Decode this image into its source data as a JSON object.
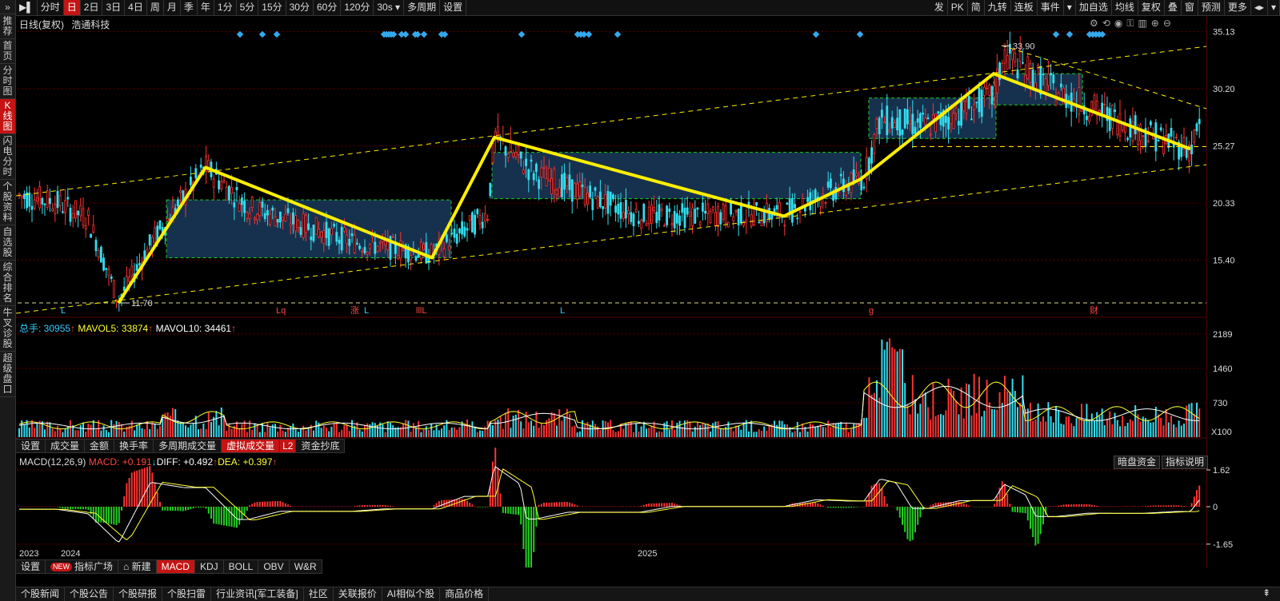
{
  "left_nav": [
    "推荐",
    "首页",
    "分时图",
    "K线图",
    "闪电分时",
    "个股资料",
    "自选股",
    "综合排名",
    "牛叉诊股",
    "超级盘口"
  ],
  "left_nav_active": 3,
  "toolbar": {
    "left": [
      "分时",
      "日",
      "2日",
      "3日",
      "4日",
      "周",
      "月",
      "季",
      "年",
      "1分",
      "5分",
      "15分",
      "30分",
      "60分",
      "120分",
      "30s ▾",
      "多周期",
      "设置"
    ],
    "active_index": 1,
    "right": [
      "发",
      "PK",
      "简",
      "九转",
      "连板",
      "事件",
      "▾",
      "加自选",
      "均线",
      "复权",
      "叠",
      "窗",
      "预测",
      "更多",
      "◂▸",
      "▾"
    ]
  },
  "header": {
    "mode": "日线(复权)",
    "stock_name": "浩通科技"
  },
  "price_axis": [
    "35.13",
    "30.20",
    "25.27",
    "20.33",
    "15.40"
  ],
  "price_annotations": {
    "high": "33.90",
    "low": "11.70"
  },
  "markers": [
    {
      "text": "L",
      "color": "#33ccff"
    },
    {
      "text": "Lq",
      "color": "#ff4444"
    },
    {
      "text": "涨",
      "color": "#ff4444"
    },
    {
      "text": "L",
      "color": "#33ccff"
    },
    {
      "text": "lllL",
      "color": "#ff4444"
    },
    {
      "text": "L",
      "color": "#33ccff"
    },
    {
      "text": "g",
      "color": "#ff4444"
    },
    {
      "text": "财",
      "color": "#ff4444"
    }
  ],
  "volume": {
    "total_label": "总手: ",
    "total_value": "30955",
    "ma5_label": "MAVOL5: ",
    "ma5_value": "33874",
    "ma10_label": "MAVOL10: ",
    "ma10_value": "34461",
    "axis": [
      "2189",
      "1460",
      "730",
      "X100"
    ]
  },
  "volume_tabs": [
    "设置",
    "成交量",
    "金额",
    "换手率",
    "多周期成交量",
    "虚拟成交量",
    "L2",
    "资金抄底"
  ],
  "volume_tab_active": 5,
  "macd": {
    "name": "MACD(12,26,9)",
    "macd_label": "MACD: ",
    "macd_value": "+0.191",
    "diff_label": "DIFF: ",
    "diff_value": "+0.492",
    "dea_label": "DEA: ",
    "dea_value": "+0.397",
    "axis": [
      "1.62",
      "0",
      "-1.65"
    ],
    "buttons": [
      "暗盘资金",
      "指标说明"
    ]
  },
  "time_axis": [
    "2023",
    "2024",
    "2025"
  ],
  "indicator_tabs": {
    "settings": "设置",
    "new_badge": "NEW",
    "square": "指标广场",
    "create": "新建",
    "items": [
      "MACD",
      "KDJ",
      "BOLL",
      "OBV",
      "W&R"
    ],
    "active": "MACD"
  },
  "news_tabs": [
    "个股新闻",
    "个股公告",
    "个股研报",
    "个股扫雷",
    "行业资讯[军工装备]",
    "社区",
    "关联报价",
    "AI相似个股",
    "商品价格"
  ],
  "colors": {
    "up": "#ff3333",
    "down": "#33ddee",
    "ma5": "#ffff33",
    "ma10": "#ffffff",
    "trend": "#ffee00",
    "box_fill": "#1a3a5a",
    "box_border": "#22cc22",
    "bg": "#000000",
    "grid": "#5a0000"
  }
}
